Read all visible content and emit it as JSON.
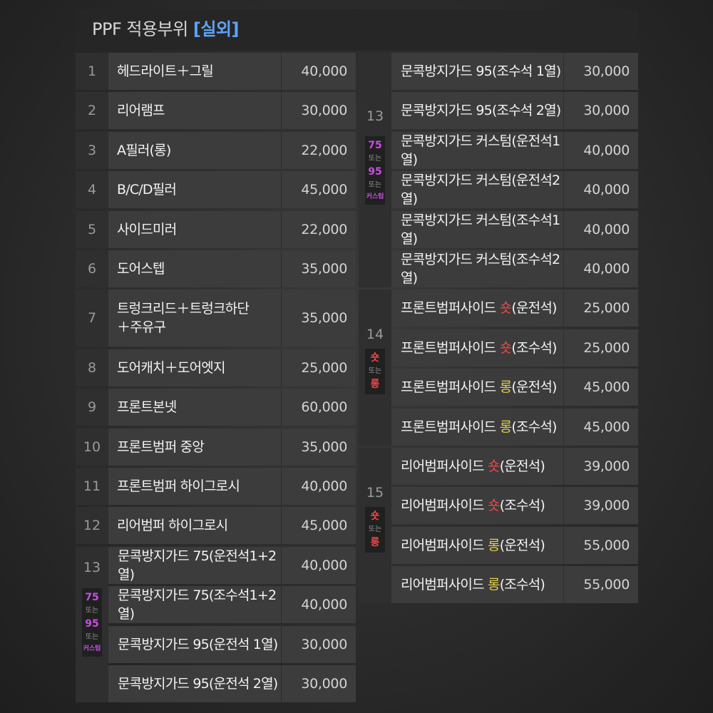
{
  "header": {
    "title": "PPF 적용부위",
    "highlight": "[실외]"
  },
  "left_rows": [
    {
      "num": "1",
      "name": "헤드라이트＋그릴",
      "price": "40,000"
    },
    {
      "num": "2",
      "name": "리어램프",
      "price": "30,000"
    },
    {
      "num": "3",
      "name": "A필러(롱)",
      "price": "22,000"
    },
    {
      "num": "4",
      "name": "B/C/D필러",
      "price": "45,000"
    },
    {
      "num": "5",
      "name": "사이드미러",
      "price": "22,000"
    },
    {
      "num": "6",
      "name": "도어스텝",
      "price": "35,000"
    },
    {
      "num": "7",
      "name": "트렁크리드＋트렁크하단\n＋주유구",
      "price": "35,000"
    },
    {
      "num": "8",
      "name": "도어캐치＋도어엣지",
      "price": "25,000"
    },
    {
      "num": "9",
      "name": "프론트본넷",
      "price": "60,000"
    },
    {
      "num": "10",
      "name": "프론트범퍼 중앙",
      "price": "35,000"
    },
    {
      "num": "11",
      "name": "프론트범퍼 하이그로시",
      "price": "40,000"
    },
    {
      "num": "12",
      "name": "리어범퍼 하이그로시",
      "price": "45,000"
    }
  ],
  "left_group": {
    "num": "13",
    "badge": [
      "75",
      "또는",
      "95",
      "또는",
      "커스텀"
    ],
    "items": [
      {
        "name": "문콕방지가드 75(운전석1+2열)",
        "price": "40,000"
      },
      {
        "name": "문콕방지가드 75(조수석1+2열)",
        "price": "40,000"
      },
      {
        "name": "문콕방지가드 95(운전석 1열)",
        "price": "30,000"
      },
      {
        "name": "문콕방지가드 95(운전석 2열)",
        "price": "30,000"
      }
    ]
  },
  "right_groups": [
    {
      "num": "13",
      "badge": [
        "75",
        "또는",
        "95",
        "또는",
        "커스텀"
      ],
      "items": [
        {
          "name": "문콕방지가드 95(조수석 1열)",
          "price": "30,000"
        },
        {
          "name": "문콕방지가드 95(조수석 2열)",
          "price": "30,000"
        },
        {
          "name": "문콕방지가드 커스텀(운전석1열)",
          "price": "40,000"
        },
        {
          "name": "문콕방지가드 커스텀(운전석2열)",
          "price": "40,000"
        },
        {
          "name": "문콕방지가드 커스텀(조수석1열)",
          "price": "40,000"
        },
        {
          "name": "문콕방지가드 커스텀(조수석2열)",
          "price": "40,000"
        }
      ]
    },
    {
      "num": "14",
      "badge": [
        "숏",
        "또는",
        "롱"
      ],
      "items": [
        {
          "pre": "프론트범퍼사이드 ",
          "tag": "숏",
          "post": "(운전석)",
          "price": "25,000"
        },
        {
          "pre": "프론트범퍼사이드 ",
          "tag": "숏",
          "post": "(조수석)",
          "price": "25,000"
        },
        {
          "pre": "프론트범퍼사이드 ",
          "tag": "롱",
          "post": "(운전석)",
          "price": "45,000"
        },
        {
          "pre": "프론트범퍼사이드 ",
          "tag": "롱",
          "post": "(조수석)",
          "price": "45,000"
        }
      ]
    },
    {
      "num": "15",
      "badge": [
        "숏",
        "또는",
        "롱"
      ],
      "items": [
        {
          "pre": "리어범퍼사이드 ",
          "tag": "숏",
          "post": "(운전석)",
          "price": "39,000"
        },
        {
          "pre": "리어범퍼사이드 ",
          "tag": "숏",
          "post": "(조수석)",
          "price": "39,000"
        },
        {
          "pre": "리어범퍼사이드 ",
          "tag": "롱",
          "post": "(운전석)",
          "price": "55,000"
        },
        {
          "pre": "리어범퍼사이드 ",
          "tag": "롱",
          "post": "(조수석)",
          "price": "55,000"
        }
      ]
    }
  ],
  "colors": {
    "accent": "#5fa2f6",
    "badge_purple": "#c94ee3",
    "short_red": "#f04848",
    "long_yellow": "#e3cf4a",
    "row_bg": "#3c3c3c",
    "num_bg": "#2f2f2f"
  }
}
